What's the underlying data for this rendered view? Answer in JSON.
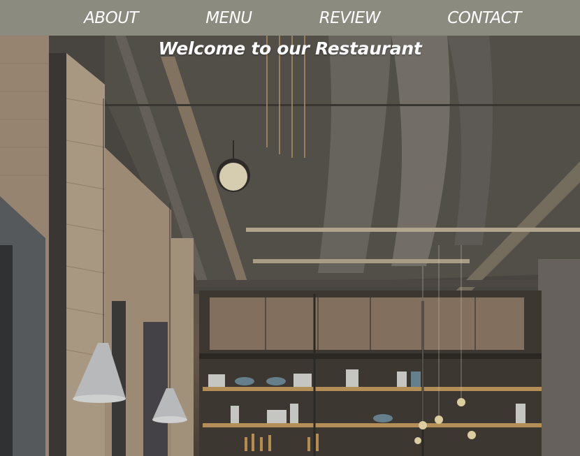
{
  "nav": {
    "items": [
      {
        "label": "ABOUT"
      },
      {
        "label": "MENU"
      },
      {
        "label": "REVIEW"
      },
      {
        "label": "CONTACT"
      }
    ]
  },
  "hero": {
    "title": "Welcome to our Restaurant",
    "image": "restaurant-interior-photo"
  },
  "colors": {
    "navbar_bg": "#8c8b80",
    "nav_text": "#ffffff",
    "title_text": "#ffffff"
  }
}
